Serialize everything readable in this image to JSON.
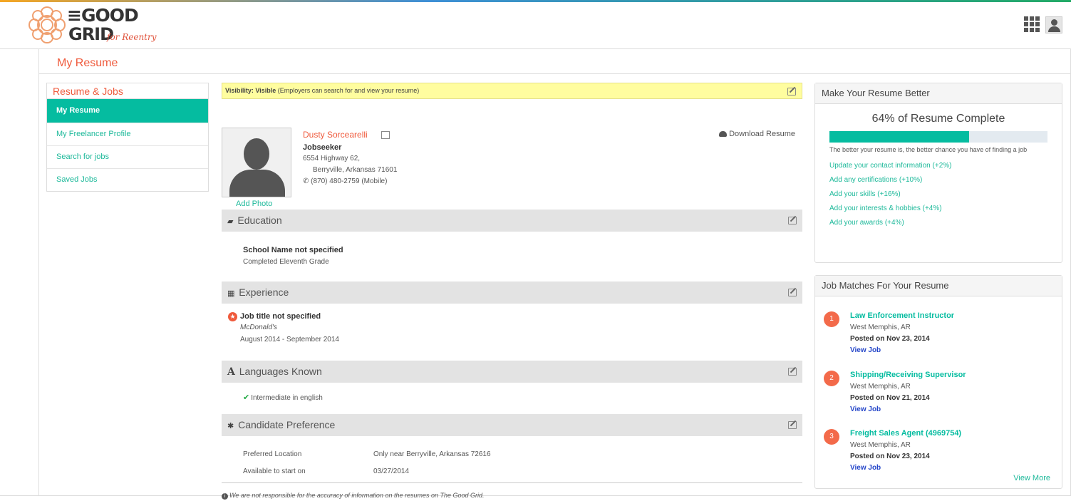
{
  "header": {
    "logo_line1": "≡GOOD",
    "logo_line2": "GRID",
    "logo_tagline": "for Reentry"
  },
  "page_title": "My Resume",
  "sidebar": {
    "title": "Resume & Jobs",
    "items": [
      {
        "label": "My Resume"
      },
      {
        "label": "My Freelancer Profile"
      },
      {
        "label": "Search for jobs"
      },
      {
        "label": "Saved Jobs"
      }
    ]
  },
  "visibility": {
    "label": "Visibility: Visible",
    "note": "(Employers can search for and view your resume)"
  },
  "profile": {
    "name": "Dusty Sorcearelli",
    "role": "Jobseeker",
    "address1": "6554 Highway 62,",
    "address2": "Berryville, Arkansas  71601",
    "phone": "(870) 480-2759 (Mobile)",
    "add_photo": "Add Photo",
    "download": "Download Resume"
  },
  "education": {
    "title": "Education",
    "school": "School Name not specified",
    "grade": "Completed Eleventh Grade"
  },
  "experience": {
    "title": "Experience",
    "job_title": "Job title not specified",
    "company": "McDonald's",
    "dates": "August 2014 - September 2014"
  },
  "languages": {
    "title": "Languages Known",
    "item": "Intermediate in english"
  },
  "preference": {
    "title": "Candidate Preference",
    "loc_label": "Preferred Location",
    "loc_value": "Only near Berryville, Arkansas 72616",
    "start_label": "Available to start on",
    "start_value": "03/27/2014"
  },
  "disclaimer": "We are not responsible for the accuracy of information on the resumes on The Good Grid.",
  "better": {
    "title": "Make Your Resume Better",
    "percent_text": "64% of Resume Complete",
    "percent": 64,
    "desc": "The better your resume is, the better chance you have of finding a job",
    "links": [
      {
        "label": "Update your contact information (+2%)"
      },
      {
        "label": "Add any certifications (+10%)"
      },
      {
        "label": "Add your skills (+16%)"
      },
      {
        "label": "Add your interests & hobbies (+4%)"
      },
      {
        "label": "Add your awards (+4%)"
      }
    ]
  },
  "matches": {
    "title": "Job Matches For Your Resume",
    "items": [
      {
        "num": "1",
        "title": "Law Enforcement Instructor",
        "location": "West Memphis, AR",
        "posted": "Posted on Nov 23, 2014",
        "view": "View Job"
      },
      {
        "num": "2",
        "title": "Shipping/Receiving Supervisor",
        "location": "West Memphis, AR",
        "posted": "Posted on Nov 21, 2014",
        "view": "View Job"
      },
      {
        "num": "3",
        "title": "Freight Sales Agent (4969754)",
        "location": "West Memphis, AR",
        "posted": "Posted on Nov 23, 2014",
        "view": "View Job"
      }
    ],
    "view_more": "View More"
  },
  "colors": {
    "accent": "#05bca0",
    "brand_red": "#ef5a3c"
  }
}
